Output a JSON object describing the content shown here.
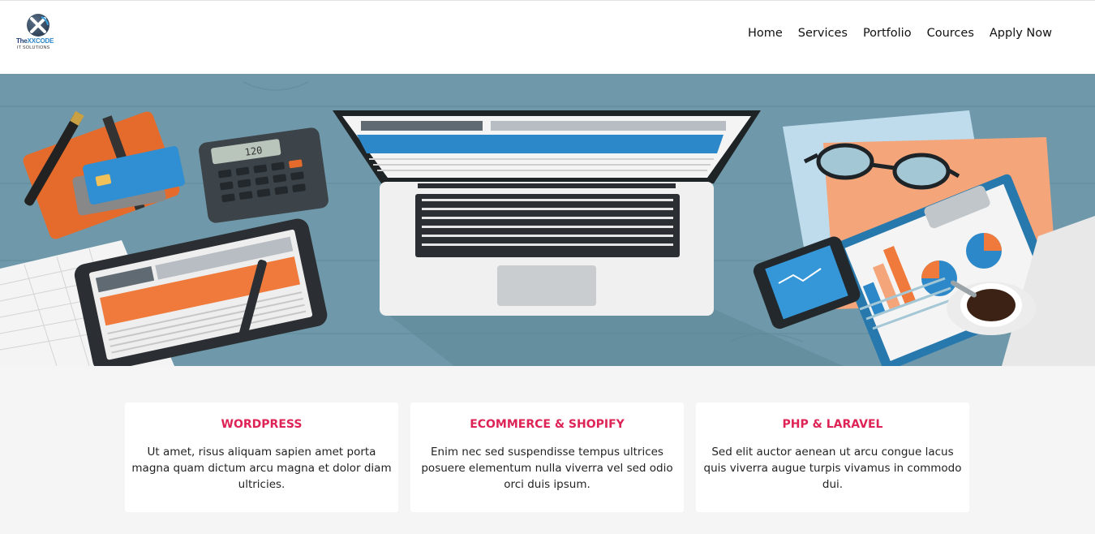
{
  "logo": {
    "name_prefix": "The",
    "name_accent": "XXCODE",
    "subtitle": "IT SOLUTIONS"
  },
  "nav": {
    "items": [
      "Home",
      "Services",
      "Portfolio",
      "Cources",
      "Apply Now"
    ]
  },
  "hero": {
    "calculator_display": "120"
  },
  "cards": [
    {
      "title": "WORDPRESS",
      "text": "Ut amet, risus aliquam sapien amet porta magna quam dictum arcu magna et dolor diam ultricies."
    },
    {
      "title": "ECOMMERCE & SHOPIFY",
      "text": "Enim nec sed suspendisse tempus ultrices posuere elementum nulla viverra vel sed odio orci duis ipsum."
    },
    {
      "title": "PHP & LARAVEL",
      "text": "Sed elit auctor aenean ut arcu congue lacus quis viverra augue turpis vivamus in commodo dui."
    }
  ]
}
